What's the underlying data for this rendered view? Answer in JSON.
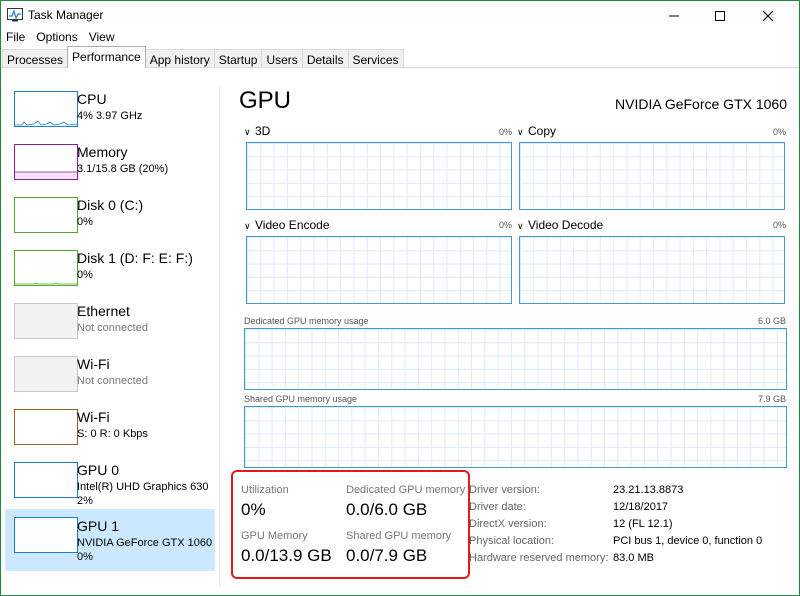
{
  "window": {
    "title": "Task Manager",
    "menu": [
      "File",
      "Options",
      "View"
    ],
    "tabs": [
      "Processes",
      "Performance",
      "App history",
      "Startup",
      "Users",
      "Details",
      "Services"
    ],
    "active_tab": "Performance"
  },
  "sidebar": {
    "items": [
      {
        "name": "CPU",
        "sub": "4% 3.97 GHz",
        "color": "#1a7fc4"
      },
      {
        "name": "Memory",
        "sub": "3.1/15.8 GB (20%)",
        "color": "#8b19a8"
      },
      {
        "name": "Disk 0 (C:)",
        "sub": "0%",
        "color": "#4ca92b"
      },
      {
        "name": "Disk 1 (D: F: E: F:)",
        "sub": "0%",
        "color": "#4ca92b"
      },
      {
        "name": "Ethernet",
        "sub": "Not connected",
        "color": "#c8c8c8"
      },
      {
        "name": "Wi-Fi",
        "sub": "Not connected",
        "color": "#c8c8c8"
      },
      {
        "name": "Wi-Fi",
        "sub": "S: 0 R: 0 Kbps",
        "color": "#a75a1e"
      },
      {
        "name": "GPU 0",
        "sub": "Intel(R) UHD Graphics 630",
        "sub2": "2%",
        "color": "#1a7fc4"
      },
      {
        "name": "GPU 1",
        "sub": "NVIDIA GeForce GTX 1060",
        "sub2": "0%",
        "color": "#1a7fc4"
      }
    ]
  },
  "main": {
    "title": "GPU",
    "model": "NVIDIA GeForce GTX 1060",
    "engines": [
      {
        "label": "3D",
        "pct": "0%"
      },
      {
        "label": "Copy",
        "pct": "0%"
      },
      {
        "label": "Video Encode",
        "pct": "0%"
      },
      {
        "label": "Video Decode",
        "pct": "0%"
      }
    ],
    "dedicated": {
      "label": "Dedicated GPU memory usage",
      "max": "6.0 GB"
    },
    "shared": {
      "label": "Shared GPU memory usage",
      "max": "7.9 GB"
    },
    "stats": {
      "utilization_label": "Utilization",
      "utilization": "0%",
      "dedicated_label": "Dedicated GPU memory",
      "dedicated": "0.0/6.0 GB",
      "gpu_memory_label": "GPU Memory",
      "gpu_memory": "0.0/13.9 GB",
      "shared_label": "Shared GPU memory",
      "shared": "0.0/7.9 GB"
    },
    "info": [
      {
        "label": "Driver version:",
        "value": "23.21.13.8873"
      },
      {
        "label": "Driver date:",
        "value": "12/18/2017"
      },
      {
        "label": "DirectX version:",
        "value": "12 (FL 12.1)"
      },
      {
        "label": "Physical location:",
        "value": "PCI bus 1, device 0, function 0"
      },
      {
        "label": "Hardware reserved memory:",
        "value": "83.0 MB"
      }
    ]
  }
}
